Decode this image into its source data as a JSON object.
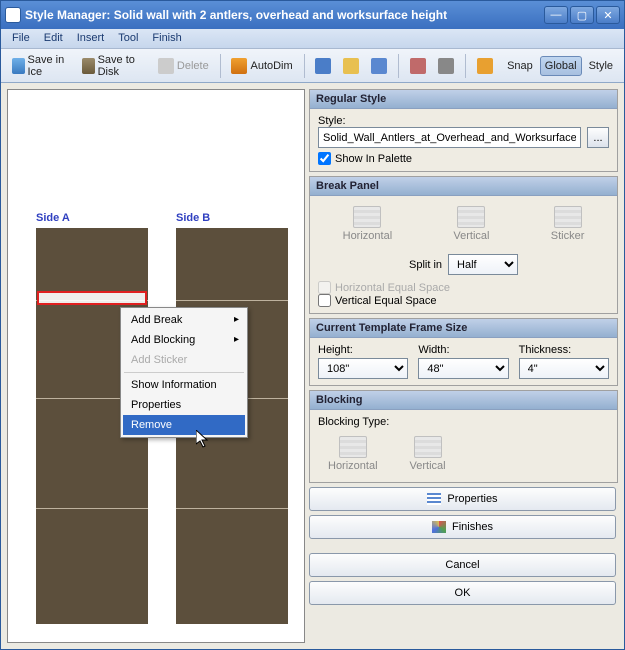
{
  "window": {
    "title": "Style Manager: Solid wall with 2 antlers, overhead and worksurface height"
  },
  "menu": {
    "file": "File",
    "edit": "Edit",
    "insert": "Insert",
    "tool": "Tool",
    "finish": "Finish"
  },
  "toolbar": {
    "saveIce": "Save in Ice",
    "saveDisk": "Save to Disk",
    "delete": "Delete",
    "autoDim": "AutoDim",
    "snap": "Snap",
    "global": "Global",
    "style": "Style"
  },
  "canvas": {
    "sideA": "Side A",
    "sideB": "Side B"
  },
  "contextMenu": {
    "addBreak": "Add Break",
    "addBlocking": "Add Blocking",
    "addSticker": "Add Sticker",
    "showInfo": "Show Information",
    "properties": "Properties",
    "remove": "Remove"
  },
  "regularStyle": {
    "header": "Regular Style",
    "styleLabel": "Style:",
    "styleValue": "Solid_Wall_Antlers_at_Overhead_and_Worksurface_H",
    "showInPalette": "Show In Palette"
  },
  "breakPanel": {
    "header": "Break Panel",
    "horizontal": "Horizontal",
    "vertical": "Vertical",
    "sticker": "Sticker",
    "splitIn": "Split in",
    "splitValue": "Half",
    "hEqual": "Horizontal Equal Space",
    "vEqual": "Vertical Equal Space"
  },
  "frameSize": {
    "header": "Current Template Frame Size",
    "heightLabel": "Height:",
    "widthLabel": "Width:",
    "thicknessLabel": "Thickness:",
    "height": "108\"",
    "width": "48\"",
    "thickness": "4\""
  },
  "blocking": {
    "header": "Blocking",
    "typeLabel": "Blocking Type:",
    "horizontal": "Horizontal",
    "vertical": "Vertical"
  },
  "buttons": {
    "properties": "Properties",
    "finishes": "Finishes",
    "cancel": "Cancel",
    "ok": "OK"
  }
}
